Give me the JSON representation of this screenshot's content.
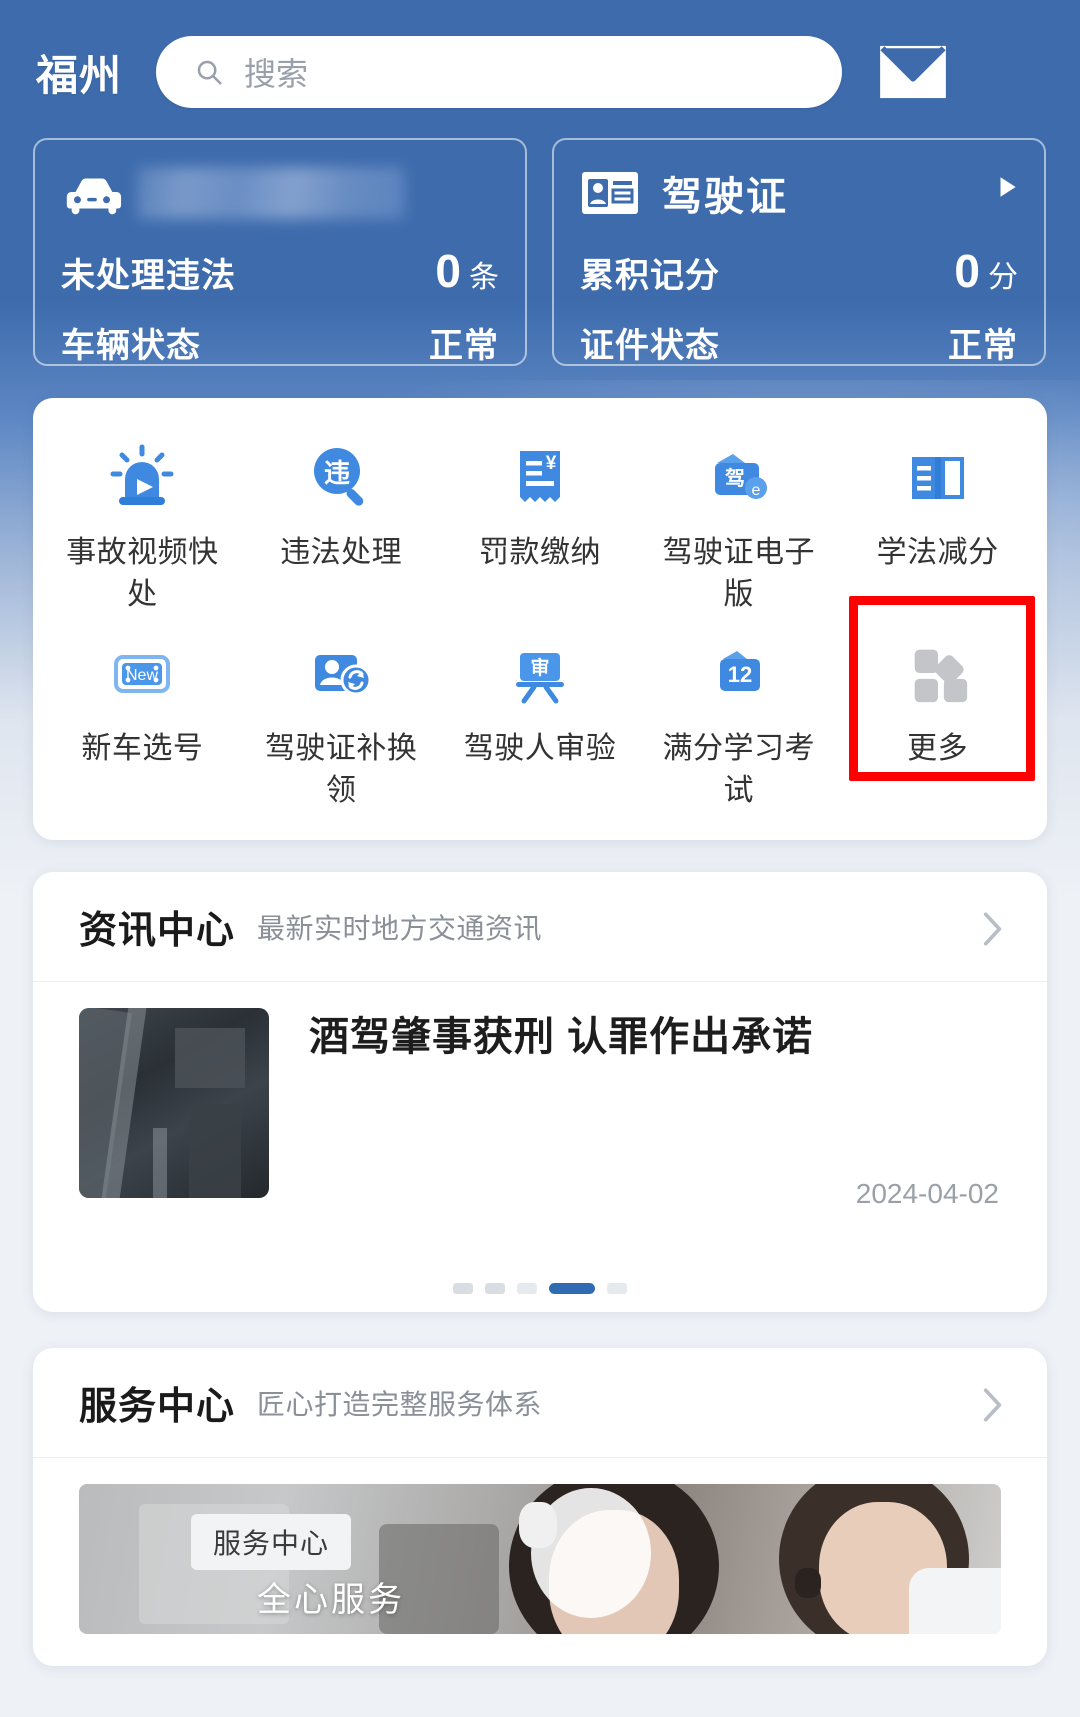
{
  "header": {
    "city": "福州",
    "search_placeholder": "搜索",
    "search_value": "",
    "search_icon": "search-icon",
    "mail_icon": "envelope-icon"
  },
  "status_cards": [
    {
      "icon": "car-icon",
      "plate_redacted": true,
      "rows": [
        {
          "label": "未处理违法",
          "value": "0",
          "unit": "条"
        },
        {
          "label": "车辆状态",
          "value": "正常",
          "unit": ""
        }
      ]
    },
    {
      "icon": "id-card-icon",
      "title": "驾驶证",
      "arrow_icon": "chevron-right-icon",
      "rows": [
        {
          "label": "累积记分",
          "value": "0",
          "unit": "分"
        },
        {
          "label": "证件状态",
          "value": "正常",
          "unit": ""
        }
      ]
    }
  ],
  "quick_actions": {
    "row1": [
      {
        "label": "事故视频快处",
        "icon": "siren-video-icon"
      },
      {
        "label": "违法处理",
        "icon": "violation-search-icon"
      },
      {
        "label": "罚款缴纳",
        "icon": "receipt-yuan-icon"
      },
      {
        "label": "驾驶证电子版",
        "icon": "e-license-wallet-icon"
      },
      {
        "label": "学法减分",
        "icon": "open-book-icon"
      }
    ],
    "row2": [
      {
        "label": "新车选号",
        "icon": "new-plate-icon"
      },
      {
        "label": "驾驶证补换领",
        "icon": "person-renew-icon"
      },
      {
        "label": "驾驶人审验",
        "icon": "inspection-board-icon"
      },
      {
        "label": "满分学习考试",
        "icon": "twelve-points-icon"
      },
      {
        "label": "更多",
        "icon": "grid-more-icon",
        "highlighted": true
      }
    ]
  },
  "news_section": {
    "title": "资讯中心",
    "subtitle": "最新实时地方交通资讯",
    "arrow_icon": "chevron-right-icon",
    "item": {
      "title": "酒驾肇事获刑 认罪作出承诺",
      "date": "2024-04-02",
      "thumbnail": "aerial-highway-photo"
    },
    "pagination": {
      "total": 5,
      "active_index": 4
    }
  },
  "service_section": {
    "title": "服务中心",
    "subtitle": "匠心打造完整服务体系",
    "arrow_icon": "chevron-right-icon",
    "banner": {
      "badge": "服务中心",
      "caption": "全心服务",
      "image": "call-center-agents-photo"
    }
  },
  "colors": {
    "header_blue": "#3d6bac",
    "accent_blue": "#3f8ae0",
    "highlight_red": "#ff0000",
    "page_bg": "#eef1f6"
  }
}
